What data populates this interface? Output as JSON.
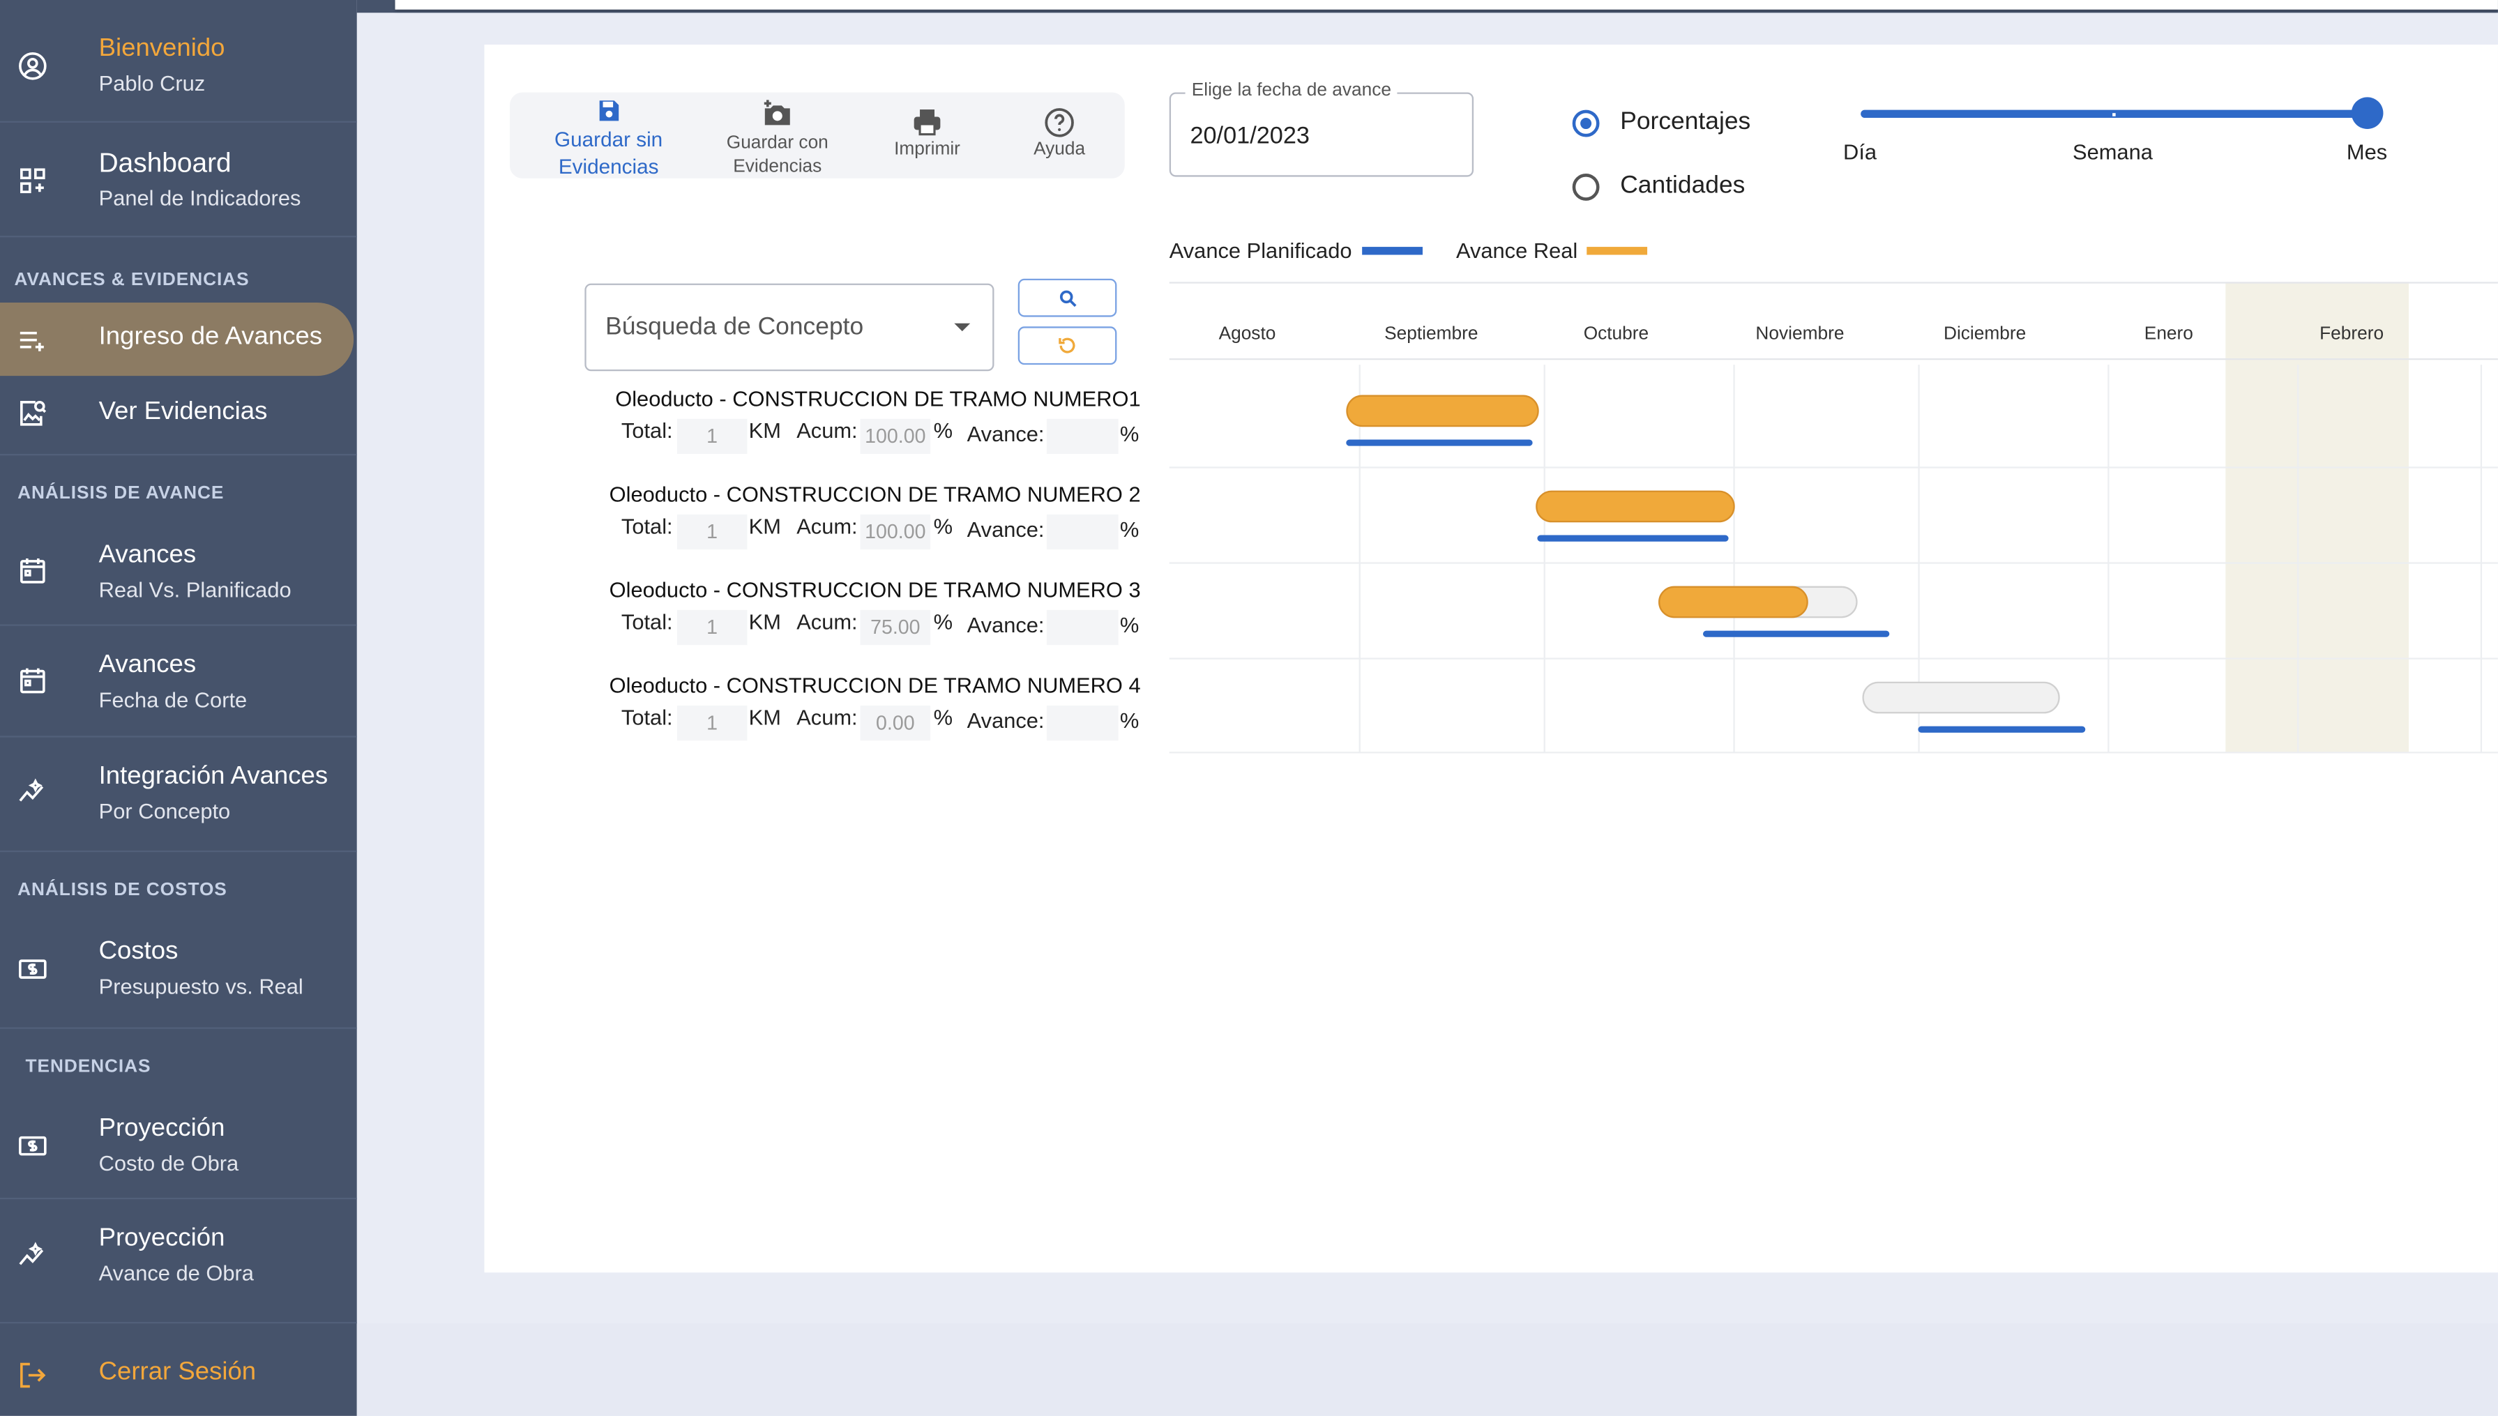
{
  "sidebar": {
    "welcome": {
      "title": "Bienvenido",
      "subtitle": "Pablo Cruz"
    },
    "dashboard": {
      "title": "Dashboard",
      "subtitle": "Panel de Indicadores"
    },
    "section_avances": "AVANCES & EVIDENCIAS",
    "ingreso": "Ingreso de Avances",
    "ver": "Ver Evidencias",
    "section_analisis": "ANÁLISIS DE AVANCE",
    "avances_real": {
      "title": "Avances",
      "subtitle": "Real Vs. Planificado"
    },
    "avances_corte": {
      "title": "Avances",
      "subtitle": "Fecha de Corte"
    },
    "integracion": {
      "title": "Integración Avances",
      "subtitle": "Por Concepto"
    },
    "section_costos": "ANÁLISIS DE COSTOS",
    "costos": {
      "title": "Costos",
      "subtitle": "Presupuesto vs. Real"
    },
    "section_tendencias": "TENDENCIAS",
    "proy_costo": {
      "title": "Proyección",
      "subtitle": "Costo de Obra"
    },
    "proy_avance": {
      "title": "Proyección",
      "subtitle": "Avance de Obra"
    },
    "logout": "Cerrar Sesión"
  },
  "toolbar": {
    "save_no_ev": {
      "line1": "Guardar sin",
      "line2": "Evidencias"
    },
    "save_ev": {
      "line1": "Guardar con",
      "line2": "Evidencias"
    },
    "print": "Imprimir",
    "help": "Ayuda"
  },
  "date": {
    "label": "Elige la fecha de avance",
    "value": "20/01/2023"
  },
  "mode": {
    "porcentajes": "Porcentajes",
    "cantidades": "Cantidades",
    "selected": "Porcentajes"
  },
  "scale": {
    "dia": "Día",
    "semana": "Semana",
    "mes": "Mes",
    "selected": "Mes"
  },
  "legend": {
    "planned": "Avance Planificado",
    "real": "Avance Real",
    "planned_color": "#2e69c8",
    "real_color": "#f0a93a"
  },
  "search": {
    "placeholder": "Búsqueda de Concepto"
  },
  "labels": {
    "total": "Total:",
    "km": "KM",
    "acum": "Acum:",
    "pct": "%",
    "avance": "Avance:"
  },
  "concepts": [
    {
      "name": "Oleoducto - CONSTRUCCION DE TRAMO NUMERO1",
      "total": "1",
      "acum": "100.00",
      "avance": ""
    },
    {
      "name": "Oleoducto - CONSTRUCCION DE TRAMO NUMERO 2",
      "total": "1",
      "acum": "100.00",
      "avance": ""
    },
    {
      "name": "Oleoducto - CONSTRUCCION DE TRAMO NUMERO 3",
      "total": "1",
      "acum": "75.00",
      "avance": ""
    },
    {
      "name": "Oleoducto - CONSTRUCCION DE TRAMO NUMERO 4",
      "total": "1",
      "acum": "0.00",
      "avance": ""
    }
  ],
  "gantt": {
    "months": [
      "Agosto",
      "Septiembre",
      "Octubre",
      "Noviembre",
      "Diciembre",
      "Enero",
      "Febrero"
    ],
    "current_month": "Febrero"
  }
}
